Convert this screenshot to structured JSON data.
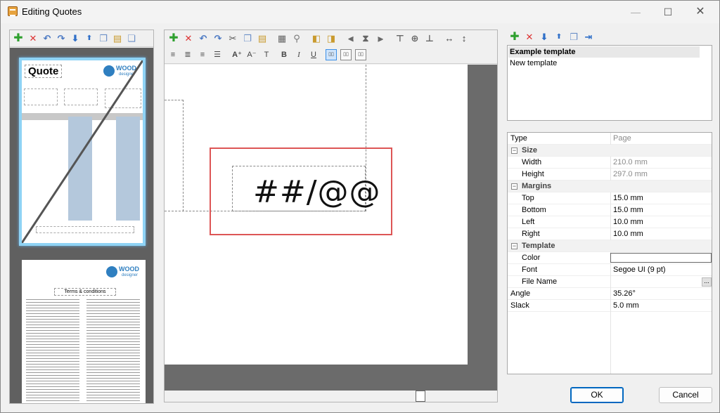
{
  "window": {
    "title": "Editing Quotes",
    "minimize": "—",
    "maximize": "☐",
    "close": "✕"
  },
  "left_toolbar": {
    "icons": [
      "add-icon",
      "delete-icon",
      "undo-icon",
      "redo-icon",
      "move-down-icon",
      "move-up-icon",
      "copy-icon",
      "paste-icon",
      "duplicate-icon"
    ]
  },
  "thumbnail1": {
    "title": "Quote",
    "logo_wood": "WOOD",
    "logo_designer": "designer"
  },
  "thumbnail2": {
    "logo_wood": "WOOD",
    "logo_designer": "designer",
    "terms": "Terms & conditions"
  },
  "canvas": {
    "text": "##/@@"
  },
  "templates": {
    "items": [
      {
        "label": "Example template"
      },
      {
        "label": "New template"
      }
    ]
  },
  "properties": {
    "type": {
      "name": "Type",
      "value": "Page"
    },
    "size": {
      "label": "Size",
      "width": {
        "name": "Width",
        "value": "210.0 mm"
      },
      "height": {
        "name": "Height",
        "value": "297.0 mm"
      }
    },
    "margins": {
      "label": "Margins",
      "top": {
        "name": "Top",
        "value": "15.0 mm"
      },
      "bottom": {
        "name": "Bottom",
        "value": "15.0 mm"
      },
      "left": {
        "name": "Left",
        "value": "10.0 mm"
      },
      "right": {
        "name": "Right",
        "value": "10.0 mm"
      }
    },
    "template": {
      "label": "Template",
      "color": {
        "name": "Color",
        "value": ""
      },
      "font": {
        "name": "Font",
        "value": "Segoe UI (9 pt)"
      },
      "file_name": {
        "name": "File Name",
        "value": ""
      }
    },
    "angle": {
      "name": "Angle",
      "value": "35.26°"
    },
    "slack": {
      "name": "Slack",
      "value": "5.0 mm"
    }
  },
  "buttons": {
    "ok": "OK",
    "cancel": "Cancel",
    "ellipsis": "..."
  }
}
